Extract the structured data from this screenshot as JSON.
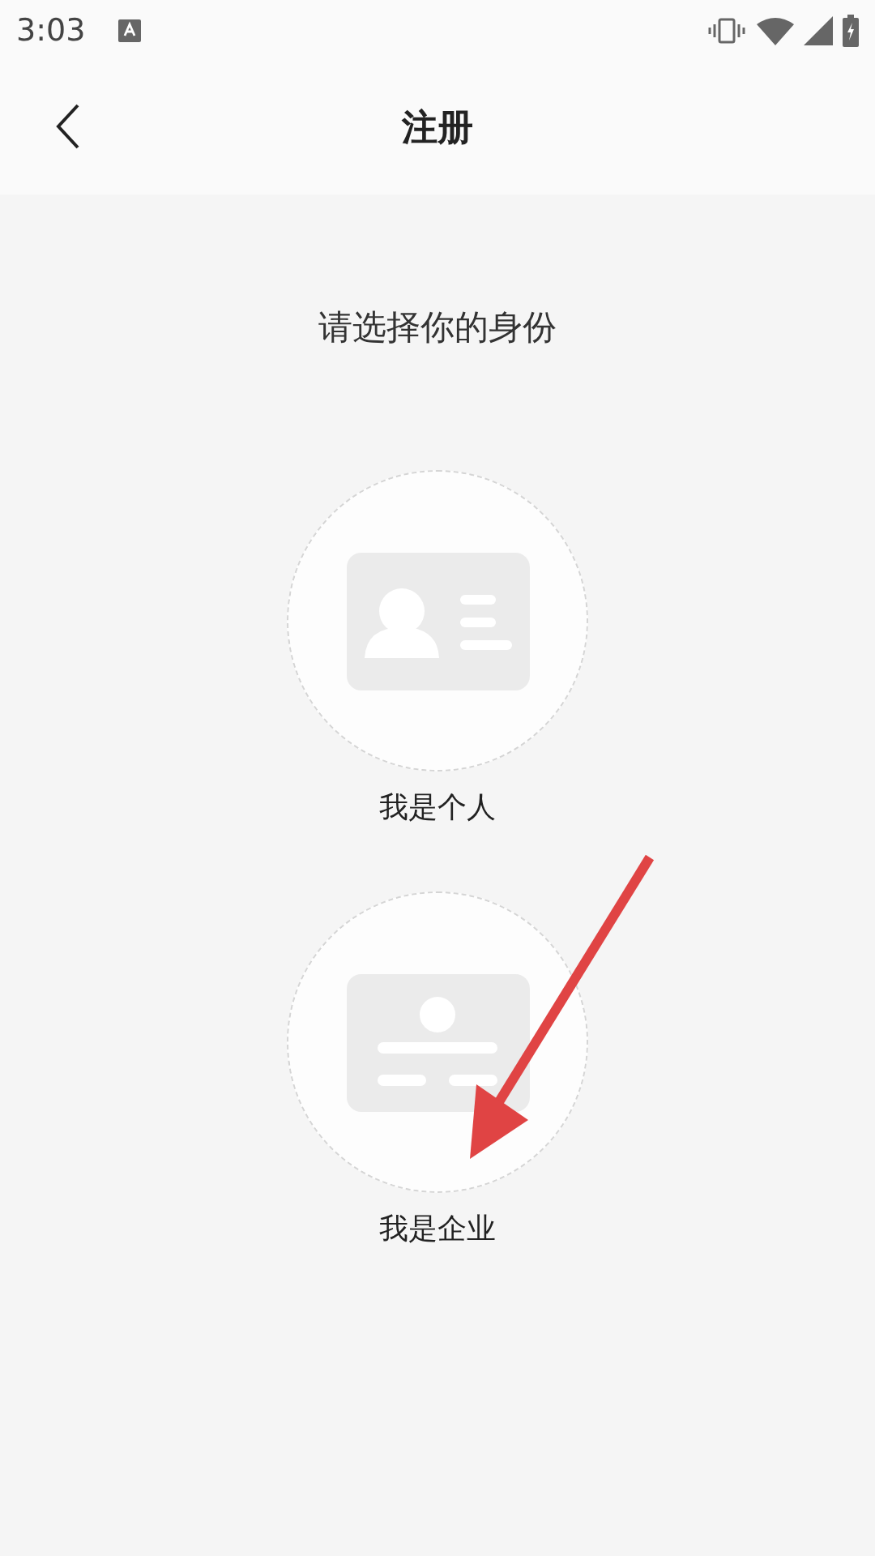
{
  "status_bar": {
    "time": "3:03"
  },
  "header": {
    "title": "注册"
  },
  "prompt": "请选择你的身份",
  "options": [
    {
      "kind": "person",
      "label": "我是个人"
    },
    {
      "kind": "company",
      "label": "我是企业"
    }
  ]
}
